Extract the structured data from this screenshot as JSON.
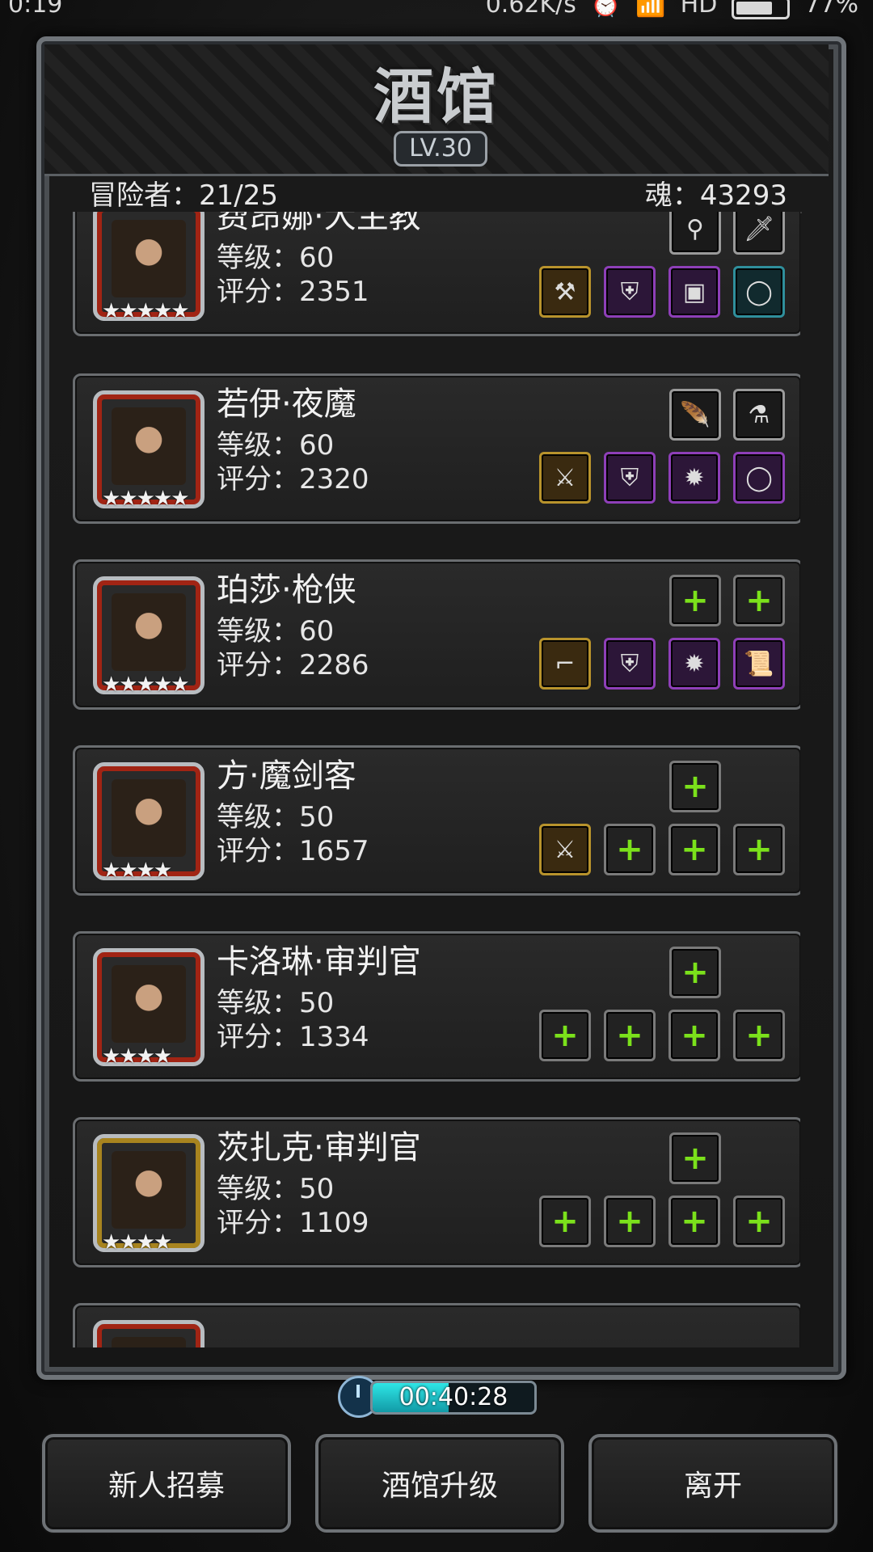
{
  "status_bar": {
    "time": "0:19",
    "network_speed": "0.62K/s",
    "hd": "HD",
    "battery": "77%"
  },
  "header": {
    "title": "酒馆",
    "level": "LV.30"
  },
  "info": {
    "adventurers": "冒险者：21/25",
    "soul": "魂：43293"
  },
  "cards": [
    {
      "name": "费昂娜·大主教",
      "level": "等级：60",
      "score": "评分：2351",
      "stars": "★★★★★",
      "accessories": [
        "necklace-icon",
        "dagger-icon"
      ],
      "equipment": [
        "axe-icon",
        "armor-icon",
        "barrel-icon",
        "ring-icon"
      ]
    },
    {
      "name": "若伊·夜魔",
      "level": "等级：60",
      "score": "评分：2320",
      "stars": "★★★★★",
      "accessories": [
        "feather-icon",
        "potion-icon"
      ],
      "equipment": [
        "sword-icon",
        "armor-icon",
        "amulet-icon",
        "ring-icon"
      ]
    },
    {
      "name": "珀莎·枪侠",
      "level": "等级：60",
      "score": "评分：2286",
      "stars": "★★★★★",
      "accessories": [
        "add-slot-icon",
        "add-slot-icon"
      ],
      "equipment": [
        "gun-icon",
        "armor-icon",
        "amulet-icon",
        "scroll-icon"
      ]
    },
    {
      "name": "方·魔剑客",
      "level": "等级：50",
      "score": "评分：1657",
      "stars": "★★★★",
      "accessories": [
        "add-slot-icon"
      ],
      "equipment": [
        "sword-icon",
        "add-slot-icon",
        "add-slot-icon",
        "add-slot-icon"
      ]
    },
    {
      "name": "卡洛琳·审判官",
      "level": "等级：50",
      "score": "评分：1334",
      "stars": "★★★★",
      "accessories": [
        "add-slot-icon"
      ],
      "equipment": [
        "add-slot-icon",
        "add-slot-icon",
        "add-slot-icon",
        "add-slot-icon"
      ]
    },
    {
      "name": "茨扎克·审判官",
      "level": "等级：50",
      "score": "评分：1109",
      "stars": "★★★★",
      "accessories": [
        "add-slot-icon"
      ],
      "equipment": [
        "add-slot-icon",
        "add-slot-icon",
        "add-slot-icon",
        "add-slot-icon"
      ]
    }
  ],
  "timer": {
    "text": "00:40:28",
    "fill_fraction": 0.47
  },
  "buttons": {
    "recruit": "新人招募",
    "upgrade": "酒馆升级",
    "leave": "离开"
  }
}
